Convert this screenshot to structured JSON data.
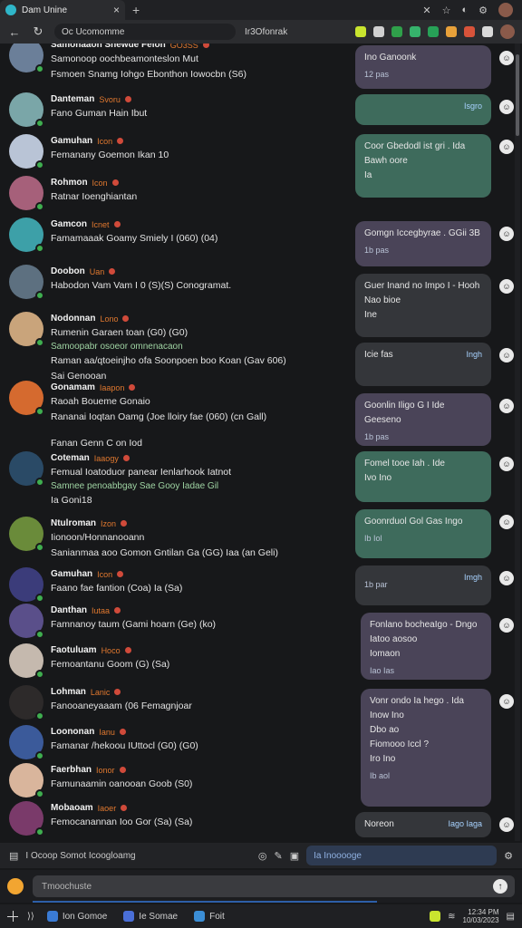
{
  "browser": {
    "tab_title": "Dam Unine",
    "close_glyph": "×",
    "address": "Oc  Ucomomme",
    "bookmark": "Ir3Ofonrak",
    "accent": "#2fb6c9"
  },
  "messages": [
    {
      "user": "Samonaaon Snewde Felon",
      "badge": "GO3SS",
      "line1": "Samonoop oochbeamonteslon Mut",
      "line2": "Fsmoen Snamg Iohgo Ebonthon Iowocbn (S6)",
      "avatar_color": "#6b7f99"
    },
    {
      "user": "Danteman",
      "badge": "Svoru",
      "line1": "Fano Guman Hain Ibut",
      "avatar_color": "#7aa6a8"
    },
    {
      "user": "Gamuhan",
      "badge": "Icon",
      "line1": "Femanany Goemon Ikan 10",
      "avatar_color": "#b9c4d6"
    },
    {
      "user": "Rohmon",
      "badge": "Icon",
      "line1": "Ratnar Ioenghiantan",
      "avatar_color": "#a6607a"
    },
    {
      "user": "Gamcon",
      "badge": "Icnet",
      "line1": "Famamaaak Goamy Smiely I (060) (04)",
      "avatar_color": "#3da0a8"
    },
    {
      "user": "Doobon",
      "badge": "Uan",
      "line1": "Habodon Vam Vam I 0 (S)(S) Conogramat.",
      "avatar_color": "#5d7080"
    },
    {
      "user": "Nodonnan",
      "badge": "Lono",
      "line1": "Rumenin Garaen toan (G0) (G0)",
      "line2": "Samoopabr osoeor omnenacaon",
      "line3": "Raman aa/qtoeinjho ofa Soonpoen boo Koan (Gav 606)",
      "line4": "Sai Genooan",
      "avatar_color": "#c9a47b"
    },
    {
      "user": "Gonamam",
      "badge": "Iaapon",
      "line1": "Raoah Boueme Gonaio",
      "line2": "Rananai Ioqtan Oamg (Joe lloiry fae (060) (cn Gall)",
      "avatar_color": "#d56a2f"
    },
    {
      "user": "",
      "badge": "",
      "line1": "Fanan Genn C on Iod",
      "avatar_color": ""
    },
    {
      "user": "Coteman",
      "badge": "Iaaogy",
      "line1": "Femual Ioatoduor panear Ienlarhook Iatnot",
      "line2": "Samnee penoabbgay Sae Gooy Iadae Gil",
      "line3": "Ia Goni18",
      "avatar_color": "#2a4a66"
    },
    {
      "user": "Ntulroman",
      "badge": "Izon",
      "line1": "Iionoon/Honnanooann",
      "line2": "Sanianmaa aoo Gomon Gntilan Ga (GG) Iaa (an Geli)",
      "avatar_color": "#6a8b3a"
    },
    {
      "user": "Gamuhan",
      "badge": "Icon",
      "line1": "Faano fae fantion (Coa) Ia (Sa)",
      "avatar_color": "#3b3c7a"
    },
    {
      "user": "Danthan",
      "badge": "Iutaa",
      "line1": "Famnanoy taum (Gami hoarn (Ge) (ko)",
      "avatar_color": "#5a4f8a"
    },
    {
      "user": "Faotuluam",
      "badge": "Hoco",
      "line1": "Femoantanu Goom (G) (Sa)",
      "avatar_color": "#c5b9ae"
    },
    {
      "user": "Lohman",
      "badge": "Lanic",
      "line1": "Fanooaneyaaam (06 Femagnjoar",
      "avatar_color": "#2d2a2a"
    },
    {
      "user": "Loononan",
      "badge": "Ianu",
      "line1": "Famanar /hekoou IUttocl (G0) (G0)",
      "avatar_color": "#3b5a9a"
    },
    {
      "user": "Faerbhan",
      "badge": "Ionor",
      "line1": "Famunaamin oanooan Goob (S0)",
      "avatar_color": "#d9b59c"
    },
    {
      "user": "Mobaoam",
      "badge": "Iaoer",
      "line1": "Femocanannan Ioo Gor (Sa) (Sa)",
      "avatar_color": "#7a3a6a"
    }
  ],
  "bubbles": [
    {
      "title": "Ino Ganoonk",
      "meta": "12 pas",
      "right": "",
      "style": "purple"
    },
    {
      "title": "",
      "meta": "",
      "right": "Isgro",
      "style": "green"
    },
    {
      "title": "Coor Gbedodl ist gri . Ida",
      "line2": "Bawh oore",
      "line3": "Ia",
      "meta": "",
      "right": "",
      "style": "green"
    },
    {
      "title": "Gomgn Iccegbyrae . GGii 3B",
      "meta": "1b pas",
      "right": "",
      "style": "purple"
    },
    {
      "title": "Guer Inand no Impo I - Hooh",
      "line2": "Nao bioe",
      "line3": "Ine",
      "meta": "",
      "right": "",
      "style": "dark"
    },
    {
      "title": "",
      "line2": "Icie fas",
      "meta": "",
      "right": "Ingh",
      "style": "dark"
    },
    {
      "title": "Goonlin Iligo G    I  Ide",
      "line2": "Geeseno",
      "meta": "1b pas",
      "right": "",
      "style": "purple"
    },
    {
      "title": "Fomel tooe Iah  . Ide",
      "line2": "Ivo Ino",
      "meta": "",
      "right": "",
      "style": "green"
    },
    {
      "title": "Goonrduol Gol Gas Ingo",
      "meta": "Ib Iol",
      "right": "",
      "style": "green"
    },
    {
      "title": "",
      "meta": "1b par",
      "right": "Imgh",
      "style": "dark"
    },
    {
      "title": "Fonlano bocheaIgo - Dngo",
      "line2": "Iatoo aosoo",
      "line3": "Iomaon",
      "meta": "Iao Ias",
      "right": "",
      "style": "purple"
    },
    {
      "title": "Vonr ondo Ia hego . Ida",
      "line2": "Inow Ino",
      "line3": "Dbo ao",
      "line4": "Fiomooo Iccl ?",
      "line5": "Iro Ino",
      "meta": "Ib aol",
      "right": "",
      "style": "purple"
    },
    {
      "title": "Noreon",
      "meta": "",
      "right": "Iago  Iaga",
      "style": "dark"
    }
  ],
  "composer": {
    "hint": "I  Ocoop Somot Icoogloamg",
    "search_placeholder": "Ia  Inooooge",
    "input_placeholder": "Tmoochuste",
    "send_glyph": "↑"
  },
  "taskbar": {
    "items": [
      "Ion Gomoe",
      "Ie Somae",
      "Foit"
    ],
    "clock_time": "12:34 PM",
    "clock_date": "10/03/2023"
  },
  "colors": {
    "bubble_purple": "#4a4458",
    "bubble_green": "#3e6b5c",
    "bubble_dark": "#34363a",
    "badge_orange": "#e0782f",
    "online_green": "#3fae4f"
  }
}
